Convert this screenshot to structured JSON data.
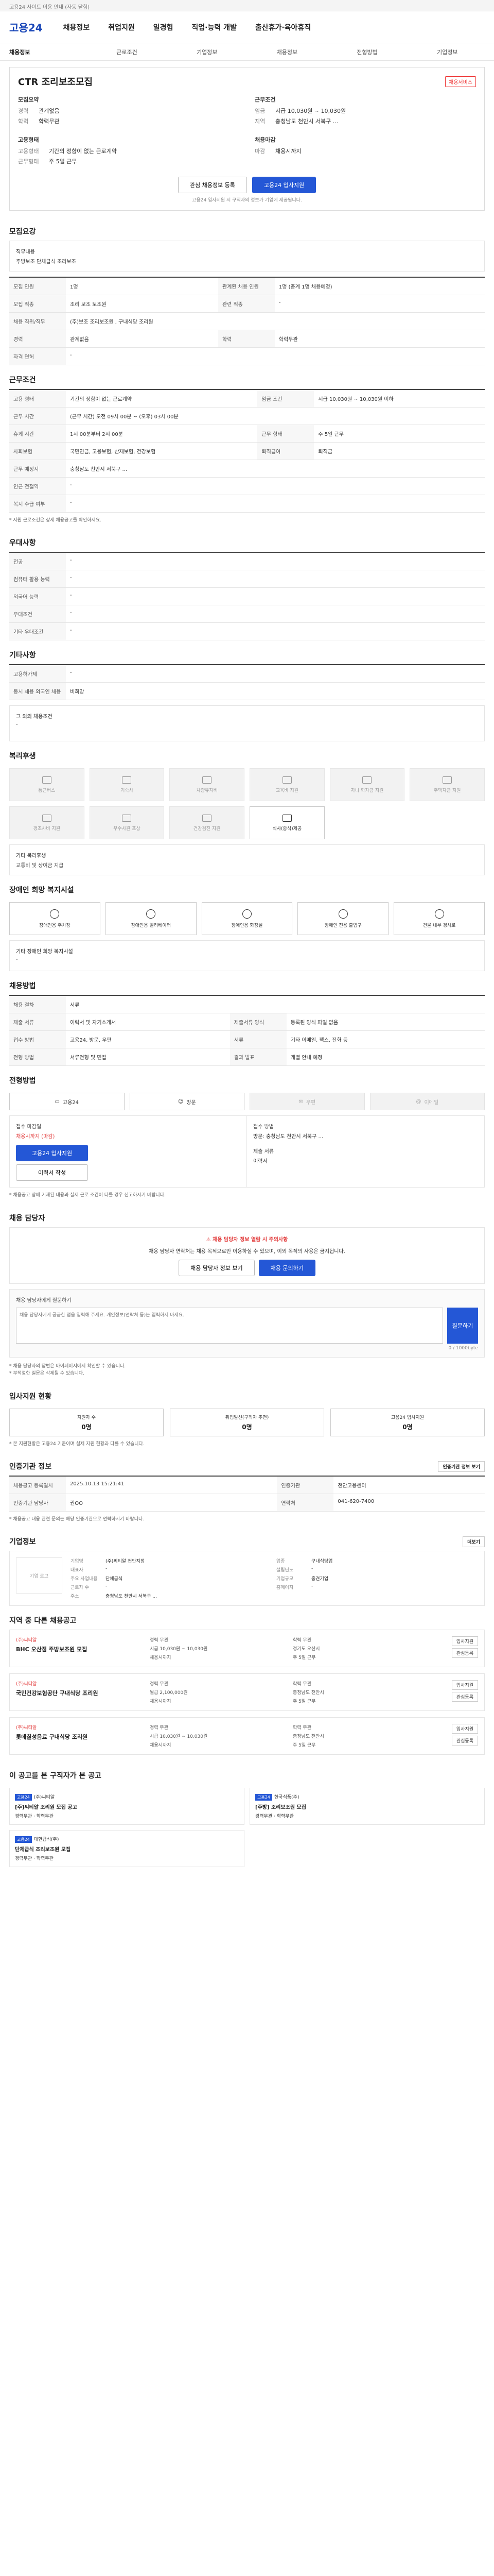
{
  "topbar": {
    "text": "고용24 사이트 이용 안내 (자동 닫힘)"
  },
  "gnb": {
    "logo_prefix": "고용",
    "logo_num": "24",
    "menu": [
      "채용정보",
      "취업지원",
      "일경험",
      "직업·능력 개발",
      "출산휴가·육아휴직"
    ]
  },
  "subnav": [
    "채용정보",
    "근로조건",
    "기업정보",
    "채용정보",
    "전형방법",
    "기업정보"
  ],
  "summary": {
    "title": "CTR 조리보조모집",
    "badge": "채용서비스",
    "left_h1": "모집요약",
    "left_kv": [
      [
        "경력",
        "관계없음"
      ],
      [
        "학력",
        "학력무관"
      ]
    ],
    "right_h1": "근무조건",
    "right_kv": [
      [
        "임금",
        "시급 10,030원 ~ 10,030원"
      ],
      [
        "지역",
        "충청남도 천안시 서북구 ..."
      ]
    ],
    "left_h2": "고용형태",
    "left_kv2": [
      [
        "고용형태",
        "기간의 정함이 없는 근로계약"
      ],
      [
        "근무형태",
        "주 5일 근무"
      ]
    ],
    "right_h2": "채용마감",
    "right_kv2": [
      [
        "마감",
        "채용시까지"
      ]
    ],
    "btn_interest": "관심 채용정보 등록",
    "btn_apply": "고용24 입사지원",
    "apply_note": "고용24 입사지원 시 구직자의 정보가 기업에 제공됩니다."
  },
  "recruit": {
    "h": "모집요강",
    "duty_label": "직무내용",
    "duty_text": "주방보조 단체급식 조리보조",
    "rows": [
      [
        "모집 인원",
        "1명",
        "관계된 채용 인원",
        "1명 (총계 1명 채용예정)"
      ],
      [
        "모집 직종",
        "조리 보조 보조원",
        "관련 직종",
        "-"
      ],
      [
        "채용 직위/직무",
        "(주)보조 조리보조원 , 구내식당 조리원",
        "",
        ""
      ],
      [
        "경력",
        "관계없음",
        "학력",
        "학력무관"
      ],
      [
        "자격 면허",
        "-",
        "",
        ""
      ]
    ]
  },
  "work": {
    "h": "근무조건",
    "rows": [
      [
        "고용 형태",
        "기간의 정함이 없는 근로계약",
        "임금 조건",
        "시급 10,030원 ~ 10,030원 이하"
      ],
      [
        "근무 시간",
        "(근무 시간) 오전 09시 00분 ~ (오후) 03시 00분",
        "",
        ""
      ],
      [
        "휴게 시간",
        "1시 00분부터 2시 00분",
        "근무 형태",
        "주 5일 근무"
      ],
      [
        "사회보험",
        "국민연금, 고용보험, 산재보험, 건강보험",
        "퇴직급여",
        "퇴직금"
      ],
      [
        "근무 예정지",
        "충청남도 천안시 서북구 ...",
        "",
        ""
      ],
      [
        "인근 전철역",
        "-",
        "",
        ""
      ],
      [
        "복지 수급 여부",
        "-",
        "",
        ""
      ]
    ],
    "note": "* 지원 근로조건은 상세 채용공고를 확인하세요."
  },
  "pref": {
    "h": "우대사항",
    "rows": [
      [
        "전공",
        "-"
      ],
      [
        "컴퓨터 활용 능력",
        "-"
      ],
      [
        "외국어 능력",
        "-"
      ],
      [
        "우대조건",
        "-"
      ],
      [
        "기타 우대조건",
        "-"
      ]
    ]
  },
  "etc": {
    "h": "기타사항",
    "rows": [
      [
        "고용허가제",
        "-"
      ],
      [
        "동시 채용 외국인 채용",
        "비희망"
      ]
    ],
    "extra_label": "그 외의 채용조건",
    "extra_val": "-"
  },
  "welfare": {
    "h": "복리후생",
    "items": [
      "통근버스",
      "기숙사",
      "차량유지비",
      "교육비 지원",
      "자녀 학자금 지원",
      "주택자금 지원",
      "경조사비 지원",
      "우수사원 포상",
      "건강검진 지원",
      "식사(중식)제공"
    ],
    "extra_label": "기타 복리후생",
    "extra_val": "교통비 및 상여금 지급"
  },
  "disabled": {
    "h": "장애인 희망 복지시설",
    "items": [
      "장애인용 주차장",
      "장애인용 엘리베이터",
      "장애인용 화장실",
      "장애인 전용 출입구",
      "건물 내부 경사로"
    ],
    "extra_label": "기타 장애인 희망 복지시설",
    "extra_val": "-"
  },
  "method": {
    "h": "채용방법",
    "rows": [
      [
        "채용 절차",
        "서류",
        "",
        ""
      ],
      [
        "제출 서류",
        "이력서 및 자기소개서",
        "제출서류 양식",
        "등록된 양식 파일 없음"
      ],
      [
        "접수 방법",
        "고용24, 방문, 우편",
        "서류",
        "기타 이메일, 팩스, 전화 등"
      ],
      [
        "전형 방법",
        "서류전형 및 면접",
        "결과 발표",
        "개별 안내 예정"
      ]
    ]
  },
  "apply_method": {
    "h": "전형방법",
    "items": [
      "고용24",
      "방문",
      "우편",
      "이메일"
    ]
  },
  "apply_period": {
    "left_label": "접수 마감일",
    "left_val": "채용시까지 (마감)",
    "left_btn": "고용24 입사지원",
    "left_btn2": "이력서 작성",
    "right_label": "접수 방법",
    "right_val": "방문: 충청남도 천안시 서북구 ...",
    "right_label2": "제출 서류",
    "right_val2": "이력서"
  },
  "notes_block": "* 채용공고 상에 기재된 내용과 실제 근로 조건이 다를 경우 신고하시기 바랍니다.",
  "contact": {
    "h": "채용 담당자",
    "alert": "채용 담당자 정보 열람 시 주의사항",
    "text": "채용 담당자 연락처는 채용 목적으로만 이용하실 수 있으며, 이외 목적의 사용은 금지됩니다.",
    "btn1": "채용 담당자 정보 보기",
    "btn2": "채용 문의하기"
  },
  "inquiry": {
    "label": "채용 담당자에게 질문하기",
    "placeholder": "채용 담당자에게 궁금한 점을 입력해 주세요. 개인정보(연락처 등)는 입력하지 마세요.",
    "count": "0 / 1000byte",
    "btn": "질문하기",
    "notes": [
      "* 채용 담당자의 답변은 마이페이지에서 확인할 수 있습니다.",
      "* 부적절한 질문은 삭제될 수 있습니다."
    ]
  },
  "status": {
    "h": "입사지원 현황",
    "items": [
      [
        "지원자 수",
        "0명"
      ],
      [
        "취업알선(구직자 추천)",
        "0명"
      ],
      [
        "고용24 입사지원",
        "0명"
      ]
    ],
    "note": "* 본 지원현황은 고용24 기준이며 실제 지원 현황과 다를 수 있습니다."
  },
  "org": {
    "h": "인증기관 정보",
    "btn": "인증기관 정보 보기",
    "rows": [
      [
        "채용공고 등록일시",
        "2025.10.13 15:21:41",
        "인증기관",
        "천안고용센터"
      ],
      [
        "인증기관 담당자",
        "권OO",
        "연락처",
        "041-620-7400"
      ]
    ],
    "note": "* 채용공고 내용 관련 문의는 해당 인증기관으로 연락하시기 바랍니다."
  },
  "company": {
    "h": "기업정보",
    "more": "더보기",
    "logo": "기업 로고",
    "rows": [
      [
        "기업명",
        "(주)씨티알 천안지점",
        "업종",
        "구내식당업"
      ],
      [
        "대표자",
        "-",
        "설립년도",
        "-"
      ],
      [
        "주요 사업내용",
        "단체급식",
        "기업규모",
        "중견기업"
      ],
      [
        "근로자 수",
        "-",
        "홈페이지",
        "-"
      ],
      [
        "주소",
        "충청남도 천안시 서북구 ...",
        "",
        ""
      ]
    ]
  },
  "similar": {
    "h": "지역 중 다른 채용공고",
    "items": [
      {
        "comp": "(주)씨티알",
        "title": "BHC 오산점 주방보조원 모집",
        "meta": [
          "경력 무관",
          "학력 무관",
          "시급 10,030원 ~ 10,030원",
          "경기도 오산시",
          "채용시까지",
          "주 5일 근무"
        ]
      },
      {
        "comp": "(주)씨티알",
        "title": "국민건강보험공단 구내식당 조리원",
        "meta": [
          "경력 무관",
          "학력 무관",
          "월급 2,100,000원",
          "충청남도 천안시",
          "채용시까지",
          "주 5일 근무"
        ]
      },
      {
        "comp": "(주)씨티알",
        "title": "롯데칠성음료 구내식당 조리원",
        "meta": [
          "경력 무관",
          "학력 무관",
          "시급 10,030원 ~ 10,030원",
          "충청남도 천안시",
          "채용시까지",
          "주 5일 근무"
        ]
      }
    ],
    "actions": [
      "입사지원",
      "관심등록"
    ]
  },
  "bottom": {
    "h": "이 공고를 본 구직자가 본 공고",
    "items": [
      {
        "tag": "고용24",
        "comp": "(주)씨티알",
        "title": "[주]씨티알 조리원 모집 공고",
        "meta": "경력무관 · 학력무관"
      },
      {
        "tag": "고용24",
        "comp": "한국식품(주)",
        "title": "[주방] 조리보조원 모집",
        "meta": "경력무관 · 학력무관"
      },
      {
        "tag": "고용24",
        "comp": "대한급식(주)",
        "title": "단체급식 조리보조원 모집",
        "meta": "경력무관 · 학력무관"
      }
    ]
  }
}
